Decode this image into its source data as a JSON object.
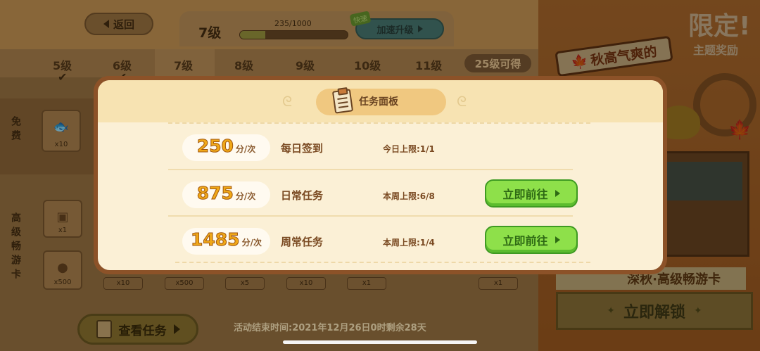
{
  "background": {
    "back_label": "返回",
    "level_label": "7级",
    "exp_text": "235/1000",
    "exp_fraction": 0.235,
    "boost_tag": "快速",
    "boost_label": "加速升级",
    "levels": [
      "5级",
      "6级",
      "7级",
      "8级",
      "9级",
      "10级",
      "11级"
    ],
    "level_25": "25级可得",
    "free_label": "免费",
    "premium_label": "高级畅游卡",
    "item_quantities_top": [
      "x10",
      "x1",
      "x500"
    ],
    "item_quantities_bottom": [
      "x10",
      "x500",
      "x5",
      "x10",
      "x1",
      "x1"
    ],
    "view_tasks_label": "查看任务",
    "event_end": "活动结束时间:2021年12月26日0时剩余28天",
    "promo": {
      "limited": "限定!",
      "theme_reward": "主题奖励",
      "autumn_banner": "秋高气爽的",
      "deep_autumn": "深秋·高级畅游卡",
      "unlock_label": "立即解锁"
    }
  },
  "task_panel": {
    "title": "任务面板",
    "tasks": [
      {
        "points": "250",
        "unit": "分/次",
        "name": "每日签到",
        "limit": "今日上限:1/1",
        "has_button": false
      },
      {
        "points": "875",
        "unit": "分/次",
        "name": "日常任务",
        "limit": "本周上限:6/8",
        "has_button": true,
        "button_label": "立即前往"
      },
      {
        "points": "1485",
        "unit": "分/次",
        "name": "周常任务",
        "limit": "本周上限:1/4",
        "has_button": true,
        "button_label": "立即前往"
      }
    ]
  },
  "colors": {
    "panel_border": "#8c5228",
    "panel_bg": "#fbf0d6",
    "points_gold": "#f0a818",
    "go_button": "#8ee04a"
  }
}
